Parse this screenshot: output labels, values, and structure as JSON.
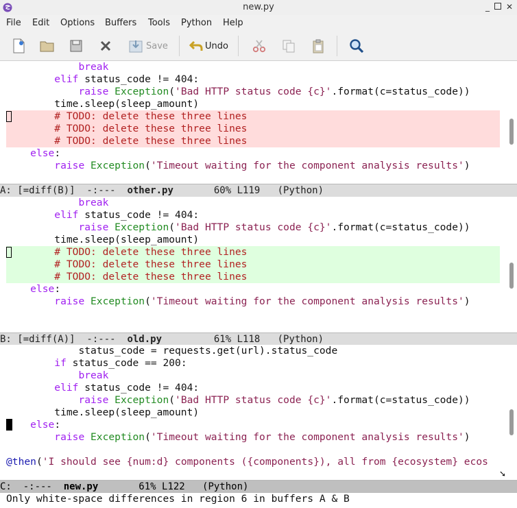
{
  "window": {
    "title": "new.py"
  },
  "menu": [
    "File",
    "Edit",
    "Options",
    "Buffers",
    "Tools",
    "Python",
    "Help"
  ],
  "toolbar": {
    "save_label": "Save",
    "undo_label": "Undo"
  },
  "panes": {
    "a": {
      "lines": [
        {
          "ind": "            ",
          "parts": [
            [
              "kw",
              "break"
            ]
          ]
        },
        {
          "ind": "        ",
          "parts": [
            [
              "kw",
              "elif"
            ],
            [
              "",
              "status_code != 404:"
            ]
          ]
        },
        {
          "ind": "            ",
          "parts": [
            [
              "kw",
              "raise "
            ],
            [
              "ty",
              "Exception"
            ],
            [
              "",
              "("
            ],
            [
              "st",
              "'Bad HTTP status code {c}'"
            ],
            [
              "",
              ".format(c=status_code))"
            ]
          ]
        },
        {
          "ind": "        ",
          "parts": [
            [
              "",
              "time.sleep(sleep_amount)"
            ]
          ]
        },
        {
          "ind": "        ",
          "parts": [
            [
              "cm",
              "# TODO: delete these three lines"
            ]
          ]
        },
        {
          "ind": "        ",
          "parts": [
            [
              "cm",
              "# TODO: delete these three lines"
            ]
          ]
        },
        {
          "ind": "        ",
          "parts": [
            [
              "cm",
              "# TODO: delete these three lines"
            ]
          ]
        },
        {
          "ind": "    ",
          "parts": [
            [
              "kw",
              "else"
            ],
            [
              "",
              ":"
            ]
          ]
        },
        {
          "ind": "        ",
          "parts": [
            [
              "kw",
              "raise "
            ],
            [
              "ty",
              "Exception"
            ],
            [
              "",
              "("
            ],
            [
              "st",
              "'Timeout waiting for the component analysis results'"
            ],
            [
              "",
              ")"
            ]
          ]
        }
      ],
      "modeline": {
        "prefix": "A: [=diff(B)]  -:---  ",
        "buffer": "other.py",
        "suffix": "       60% L119   (Python)"
      }
    },
    "b": {
      "lines": [
        {
          "ind": "            ",
          "parts": [
            [
              "kw",
              "break"
            ]
          ]
        },
        {
          "ind": "        ",
          "parts": [
            [
              "kw",
              "elif"
            ],
            [
              "",
              "status_code != 404:"
            ]
          ]
        },
        {
          "ind": "            ",
          "parts": [
            [
              "kw",
              "raise "
            ],
            [
              "ty",
              "Exception"
            ],
            [
              "",
              "("
            ],
            [
              "st",
              "'Bad HTTP status code {c}'"
            ],
            [
              "",
              ".format(c=status_code))"
            ]
          ]
        },
        {
          "ind": "        ",
          "parts": [
            [
              "",
              "time.sleep(sleep_amount)"
            ]
          ]
        },
        {
          "ind": "        ",
          "parts": [
            [
              "cm",
              "# TODO: delete these three lines"
            ]
          ]
        },
        {
          "ind": "        ",
          "parts": [
            [
              "cm",
              "# TODO: delete these three lines"
            ]
          ]
        },
        {
          "ind": "        ",
          "parts": [
            [
              "cm",
              "# TODO: delete these three lines"
            ]
          ]
        },
        {
          "ind": "    ",
          "parts": [
            [
              "kw",
              "else"
            ],
            [
              "",
              ":"
            ]
          ]
        },
        {
          "ind": "        ",
          "parts": [
            [
              "kw",
              "raise "
            ],
            [
              "ty",
              "Exception"
            ],
            [
              "",
              "("
            ],
            [
              "st",
              "'Timeout waiting for the component analysis results'"
            ],
            [
              "",
              ")"
            ]
          ]
        }
      ],
      "modeline": {
        "prefix": "B: [=diff(A)]  -:---  ",
        "buffer": "old.py",
        "suffix": "         61% L118   (Python)"
      }
    },
    "c": {
      "lines": [
        {
          "ind": "            ",
          "parts": [
            [
              "",
              "status_code = requests.get(url).status_code"
            ]
          ]
        },
        {
          "ind": "        ",
          "parts": [
            [
              "kw",
              "if"
            ],
            [
              "",
              "status_code == 200:"
            ]
          ]
        },
        {
          "ind": "            ",
          "parts": [
            [
              "kw",
              "break"
            ]
          ]
        },
        {
          "ind": "        ",
          "parts": [
            [
              "kw",
              "elif"
            ],
            [
              "",
              "status_code != 404:"
            ]
          ]
        },
        {
          "ind": "            ",
          "parts": [
            [
              "kw",
              "raise "
            ],
            [
              "ty",
              "Exception"
            ],
            [
              "",
              "("
            ],
            [
              "st",
              "'Bad HTTP status code {c}'"
            ],
            [
              "",
              ".format(c=status_code))"
            ]
          ]
        },
        {
          "ind": "        ",
          "parts": [
            [
              "",
              "time.sleep(sleep_amount)"
            ]
          ]
        },
        {
          "ind": "    ",
          "parts": [
            [
              "kw",
              "else"
            ],
            [
              "",
              ":"
            ]
          ]
        },
        {
          "ind": "        ",
          "parts": [
            [
              "kw",
              "raise "
            ],
            [
              "ty",
              "Exception"
            ],
            [
              "",
              "("
            ],
            [
              "st",
              "'Timeout waiting for the component analysis results'"
            ],
            [
              "",
              ")"
            ]
          ]
        },
        {
          "ind": "",
          "parts": [
            [
              "",
              ""
            ]
          ]
        },
        {
          "ind": "",
          "parts": [
            [
              "fn",
              "@then"
            ],
            [
              "",
              "("
            ],
            [
              "st",
              "'I should see {num:d} components ({components}), all from {ecosystem} ecos"
            ]
          ]
        }
      ],
      "modeline": {
        "prefix": "C:  -:---  ",
        "buffer": "new.py",
        "suffix": "       61% L122   (Python)"
      }
    }
  },
  "minibuffer": "Only white-space differences in region 6 in buffers A & B"
}
